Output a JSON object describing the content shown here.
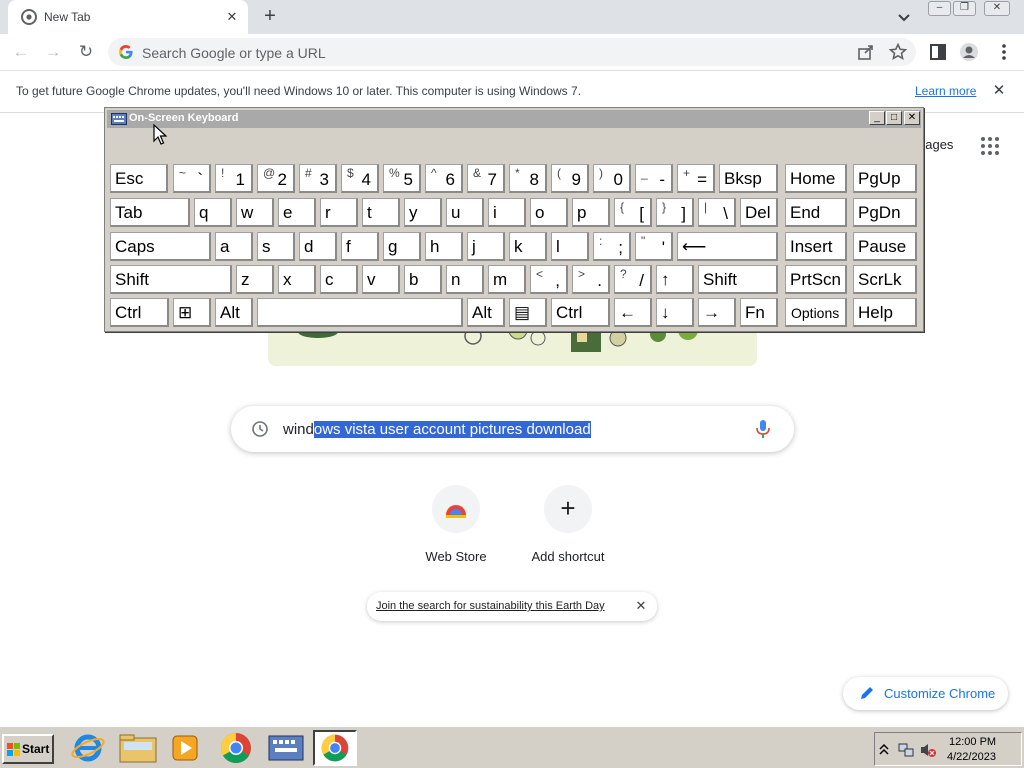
{
  "browser": {
    "tab_title": "New Tab",
    "omnibox_placeholder": "Search Google or type a URL",
    "infobar_message": "To get future Google Chrome updates, you'll need Windows 10 or later. This computer is using Windows 7.",
    "infobar_link": "Learn more"
  },
  "ntp": {
    "images_link": "nages",
    "search_query_plain": "wind",
    "search_query_selected": "ows vista user account pictures download",
    "shortcuts": [
      {
        "label": "Web Store",
        "icon": "web-store-icon"
      },
      {
        "label": "Add shortcut",
        "icon": "plus-icon"
      }
    ],
    "earth_day_link": "Join the search for sustainability this Earth Day",
    "customize_label": "Customize Chrome"
  },
  "osk": {
    "title": "On-Screen Keyboard",
    "row1": [
      {
        "label": "Esc"
      },
      {
        "top": "~",
        "bot": "`"
      },
      {
        "top": "!",
        "bot": "1"
      },
      {
        "top": "@",
        "bot": "2"
      },
      {
        "top": "#",
        "bot": "3"
      },
      {
        "top": "$",
        "bot": "4"
      },
      {
        "top": "%",
        "bot": "5"
      },
      {
        "top": "^",
        "bot": "6"
      },
      {
        "top": "&",
        "bot": "7"
      },
      {
        "top": "*",
        "bot": "8"
      },
      {
        "top": "(",
        "bot": "9"
      },
      {
        "top": ")",
        "bot": "0"
      },
      {
        "top": "_",
        "bot": "-"
      },
      {
        "top": "+",
        "bot": "="
      },
      {
        "label": "Bksp"
      },
      {
        "label": "Home"
      },
      {
        "label": "PgUp"
      }
    ],
    "row2": [
      {
        "label": "Tab"
      },
      {
        "label": "q"
      },
      {
        "label": "w"
      },
      {
        "label": "e"
      },
      {
        "label": "r"
      },
      {
        "label": "t"
      },
      {
        "label": "y"
      },
      {
        "label": "u"
      },
      {
        "label": "i"
      },
      {
        "label": "o"
      },
      {
        "label": "p"
      },
      {
        "top": "{",
        "bot": "["
      },
      {
        "top": "}",
        "bot": "]"
      },
      {
        "top": "|",
        "bot": "\\"
      },
      {
        "label": "Del"
      },
      {
        "label": "End"
      },
      {
        "label": "PgDn"
      }
    ],
    "row3": [
      {
        "label": "Caps"
      },
      {
        "label": "a"
      },
      {
        "label": "s"
      },
      {
        "label": "d"
      },
      {
        "label": "f"
      },
      {
        "label": "g"
      },
      {
        "label": "h"
      },
      {
        "label": "j"
      },
      {
        "label": "k"
      },
      {
        "label": "l"
      },
      {
        "top": ":",
        "bot": ";"
      },
      {
        "top": "\"",
        "bot": "'"
      },
      {
        "label": "⟵"
      },
      {
        "label": "Insert"
      },
      {
        "label": "Pause"
      }
    ],
    "row4": [
      {
        "label": "Shift"
      },
      {
        "label": "z"
      },
      {
        "label": "x"
      },
      {
        "label": "c"
      },
      {
        "label": "v"
      },
      {
        "label": "b"
      },
      {
        "label": "n"
      },
      {
        "label": "m"
      },
      {
        "top": "<",
        "bot": ","
      },
      {
        "top": ">",
        "bot": "."
      },
      {
        "top": "?",
        "bot": "/"
      },
      {
        "label": "↑"
      },
      {
        "label": "Shift"
      },
      {
        "label": "PrtScn"
      },
      {
        "label": "ScrLk"
      }
    ],
    "row5": [
      {
        "label": "Ctrl"
      },
      {
        "label": "⊞"
      },
      {
        "label": "Alt"
      },
      {
        "label": ""
      },
      {
        "label": "Alt"
      },
      {
        "label": "▤"
      },
      {
        "label": "Ctrl"
      },
      {
        "label": "←"
      },
      {
        "label": "↓"
      },
      {
        "label": "→"
      },
      {
        "label": "Fn"
      },
      {
        "label": "Options"
      },
      {
        "label": "Help"
      }
    ]
  },
  "taskbar": {
    "start_label": "Start",
    "time": "12:00 PM",
    "date": "4/22/2023",
    "apps": [
      "internet-explorer-icon",
      "folder-icon",
      "media-player-icon",
      "chrome-icon",
      "on-screen-keyboard-icon",
      "chrome-icon"
    ]
  },
  "colors": {
    "selection": "#3367d6",
    "link": "#1a73e8",
    "osk_face": "#d4d0c8"
  }
}
